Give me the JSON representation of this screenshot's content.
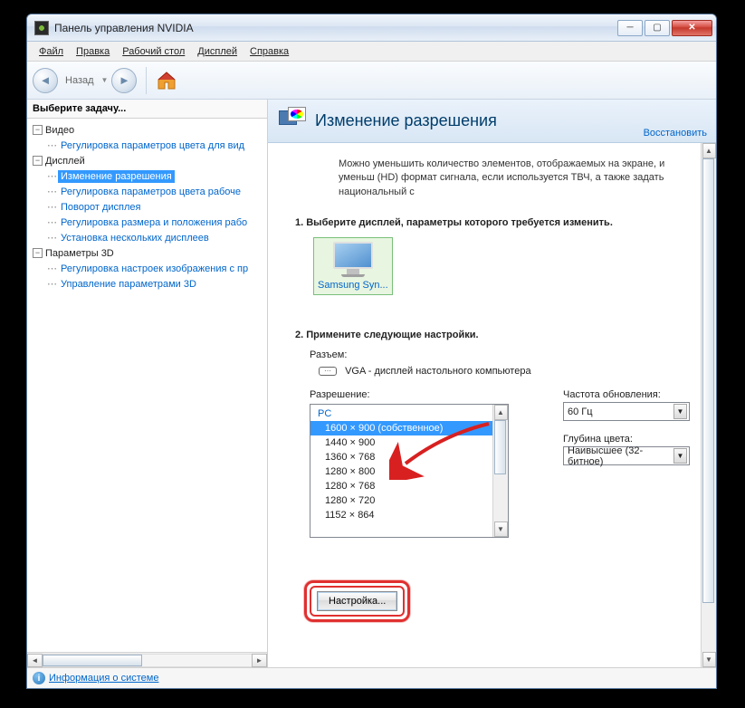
{
  "window": {
    "title": "Панель управления NVIDIA"
  },
  "menu": {
    "file": "Файл",
    "edit": "Правка",
    "desktop": "Рабочий стол",
    "display": "Дисплей",
    "help": "Справка"
  },
  "toolbar": {
    "back": "Назад"
  },
  "sidebar": {
    "header": "Выберите задачу...",
    "video": {
      "label": "Видео",
      "items": [
        "Регулировка параметров цвета для вид"
      ]
    },
    "display": {
      "label": "Дисплей",
      "items": [
        "Изменение разрешения",
        "Регулировка параметров цвета рабоче",
        "Поворот дисплея",
        "Регулировка размера и положения рабо",
        "Установка нескольких дисплеев"
      ]
    },
    "params3d": {
      "label": "Параметры 3D",
      "items": [
        "Регулировка настроек изображения с пр",
        "Управление параметрами 3D"
      ]
    }
  },
  "footer": {
    "info": "Информация о системе"
  },
  "page": {
    "title": "Изменение разрешения",
    "restore": "Восстановить",
    "description": "Можно уменьшить количество элементов, отображаемых на экране, и уменьш (HD) формат сигнала, если используется ТВЧ, а также задать национальный с",
    "step1": "1. Выберите дисплей, параметры которого требуется изменить.",
    "display_name": "Samsung Syn...",
    "step2": "2. Примените следующие настройки.",
    "connector_label": "Разъем:",
    "connector_value": "VGA - дисплей настольного компьютера",
    "resolution_label": "Разрешение:",
    "res_category": "PC",
    "resolutions": [
      "1600 × 900 (собственное)",
      "1440 × 900",
      "1360 × 768",
      "1280 × 800",
      "1280 × 768",
      "1280 × 720",
      "1152 × 864"
    ],
    "refresh_label": "Частота обновления:",
    "refresh_value": "60 Гц",
    "depth_label": "Глубина цвета:",
    "depth_value": "Наивысшее (32-битное)",
    "customize_btn": "Настройка..."
  }
}
